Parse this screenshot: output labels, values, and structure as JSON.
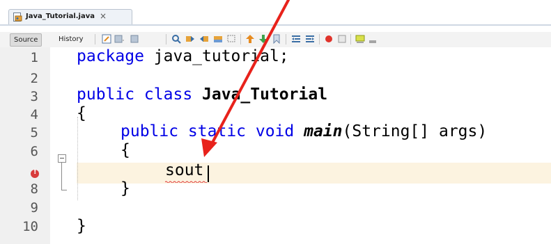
{
  "tab": {
    "label": "Java_Tutorial.java",
    "close": "×"
  },
  "toolbar": {
    "source_label": "Source",
    "history_label": "History"
  },
  "code": {
    "line_numbers": [
      "1",
      "2",
      "3",
      "4",
      "5",
      "6",
      "8",
      "9",
      "10"
    ],
    "l1_kw": "package",
    "l1_rest": " java_tutorial;",
    "l3_kw": "public class",
    "l3_cls": "Java_Tutorial",
    "l4": "{",
    "l5_kw": "public static void",
    "l5_method": "main",
    "l5_rest": "(String[] args)",
    "l6": "{",
    "l7": "sout",
    "l8": "}",
    "l10": "}"
  },
  "colors": {
    "keyword": "#0000e6",
    "highlight_line": "#fcf3e0",
    "error": "#d83b3b",
    "arrow": "#e8221b"
  }
}
